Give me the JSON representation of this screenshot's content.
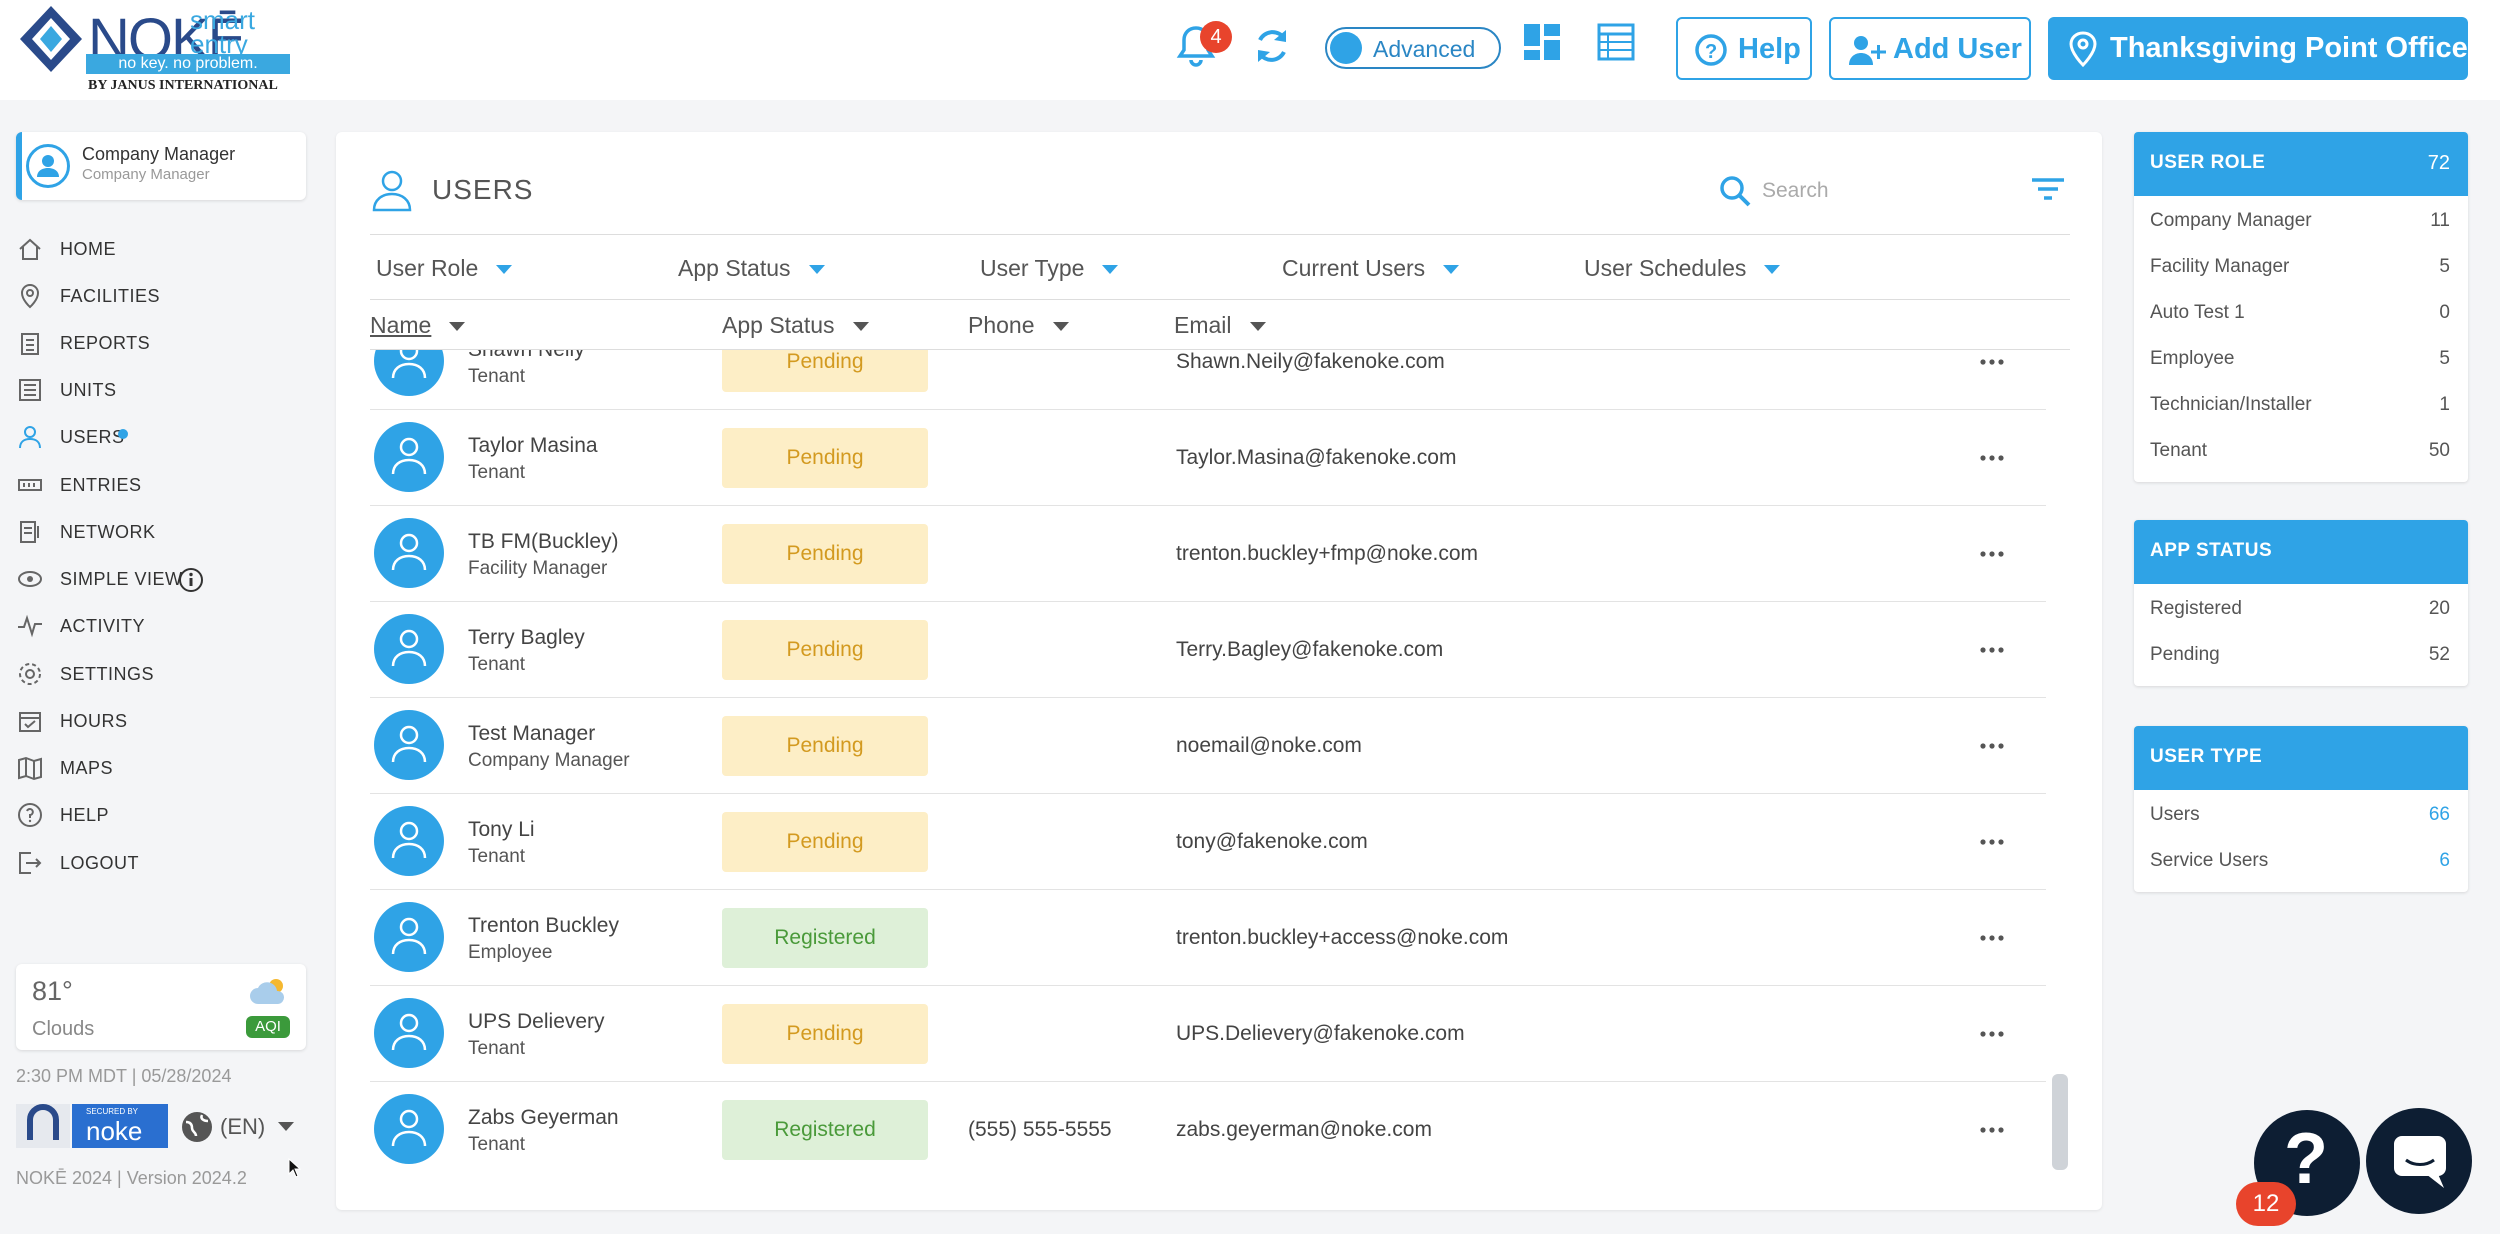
{
  "brand": {
    "name": "NOKĒ",
    "smart_entry": "smart entry",
    "tagline": "no key. no problem.",
    "by": "BY JANUS INTERNATIONAL"
  },
  "header": {
    "notification_count": "4",
    "mode_label": "Advanced",
    "help_label": "Help",
    "add_user_label": "Add User",
    "facility_label": "Thanksgiving Point Office"
  },
  "profile": {
    "name": "Company Manager",
    "role": "Company Manager"
  },
  "nav": [
    {
      "label": "HOME",
      "icon": "home-icon"
    },
    {
      "label": "FACILITIES",
      "icon": "location-pin-icon"
    },
    {
      "label": "REPORTS",
      "icon": "clipboard-icon"
    },
    {
      "label": "UNITS",
      "icon": "list-icon"
    },
    {
      "label": "USERS",
      "icon": "user-icon"
    },
    {
      "label": "ENTRIES",
      "icon": "keypad-icon"
    },
    {
      "label": "NETWORK",
      "icon": "network-icon"
    },
    {
      "label": "SIMPLE VIEW",
      "icon": "eye-icon"
    },
    {
      "label": "ACTIVITY",
      "icon": "activity-icon"
    },
    {
      "label": "SETTINGS",
      "icon": "gear-icon"
    },
    {
      "label": "HOURS",
      "icon": "calendar-icon"
    },
    {
      "label": "MAPS",
      "icon": "map-icon"
    },
    {
      "label": "HELP",
      "icon": "help-circle-icon"
    },
    {
      "label": "LOGOUT",
      "icon": "logout-icon"
    }
  ],
  "weather": {
    "temp": "81°",
    "condition": "Clouds",
    "aqi": "AQI"
  },
  "footer": {
    "datetime": "2:30 PM MDT | 05/28/2024",
    "secured_by": "SECURED BY",
    "secured_brand": "noke",
    "language": "(EN)",
    "version": "NOKĒ 2024 | Version 2024.2"
  },
  "users_panel": {
    "title": "USERS",
    "search_placeholder": "Search",
    "filters": [
      "User Role",
      "App Status",
      "User Type",
      "Current Users",
      "User Schedules"
    ],
    "columns": [
      "Name",
      "App Status",
      "Phone",
      "Email"
    ],
    "rows": [
      {
        "name": "Shawn Neily",
        "role": "Tenant",
        "status": "Pending",
        "phone": "",
        "email": "Shawn.Neily@fakenoke.com"
      },
      {
        "name": "Taylor Masina",
        "role": "Tenant",
        "status": "Pending",
        "phone": "",
        "email": "Taylor.Masina@fakenoke.com"
      },
      {
        "name": "TB FM(Buckley)",
        "role": "Facility Manager",
        "status": "Pending",
        "phone": "",
        "email": "trenton.buckley+fmp@noke.com"
      },
      {
        "name": "Terry Bagley",
        "role": "Tenant",
        "status": "Pending",
        "phone": "",
        "email": "Terry.Bagley@fakenoke.com"
      },
      {
        "name": "Test Manager",
        "role": "Company Manager",
        "status": "Pending",
        "phone": "",
        "email": "noemail@noke.com"
      },
      {
        "name": "Tony Li",
        "role": "Tenant",
        "status": "Pending",
        "phone": "",
        "email": "tony@fakenoke.com"
      },
      {
        "name": "Trenton Buckley",
        "role": "Employee",
        "status": "Registered",
        "phone": "",
        "email": "trenton.buckley+access@noke.com"
      },
      {
        "name": "UPS Delievery",
        "role": "Tenant",
        "status": "Pending",
        "phone": "",
        "email": "UPS.Delievery@fakenoke.com"
      },
      {
        "name": "Zabs Geyerman",
        "role": "Tenant",
        "status": "Registered",
        "phone": "(555) 555-5555",
        "email": "zabs.geyerman@noke.com"
      }
    ]
  },
  "stats": {
    "user_role": {
      "title": "USER ROLE",
      "total": "72",
      "items": [
        {
          "label": "Company Manager",
          "value": "11"
        },
        {
          "label": "Facility Manager",
          "value": "5"
        },
        {
          "label": "Auto Test 1",
          "value": "0"
        },
        {
          "label": "Employee",
          "value": "5"
        },
        {
          "label": "Technician/Installer",
          "value": "1"
        },
        {
          "label": "Tenant",
          "value": "50"
        }
      ]
    },
    "app_status": {
      "title": "APP STATUS",
      "items": [
        {
          "label": "Registered",
          "value": "20"
        },
        {
          "label": "Pending",
          "value": "52"
        }
      ]
    },
    "user_type": {
      "title": "USER TYPE",
      "items": [
        {
          "label": "Users",
          "value": "66"
        },
        {
          "label": "Service Users",
          "value": "6"
        }
      ]
    }
  },
  "widgets": {
    "help_symbol": "?",
    "help_badge": "12"
  },
  "colors": {
    "accent": "#2fa3e6",
    "pending_bg": "#fdeec6",
    "registered_bg": "#def0d8",
    "badge_red": "#e8442c"
  }
}
